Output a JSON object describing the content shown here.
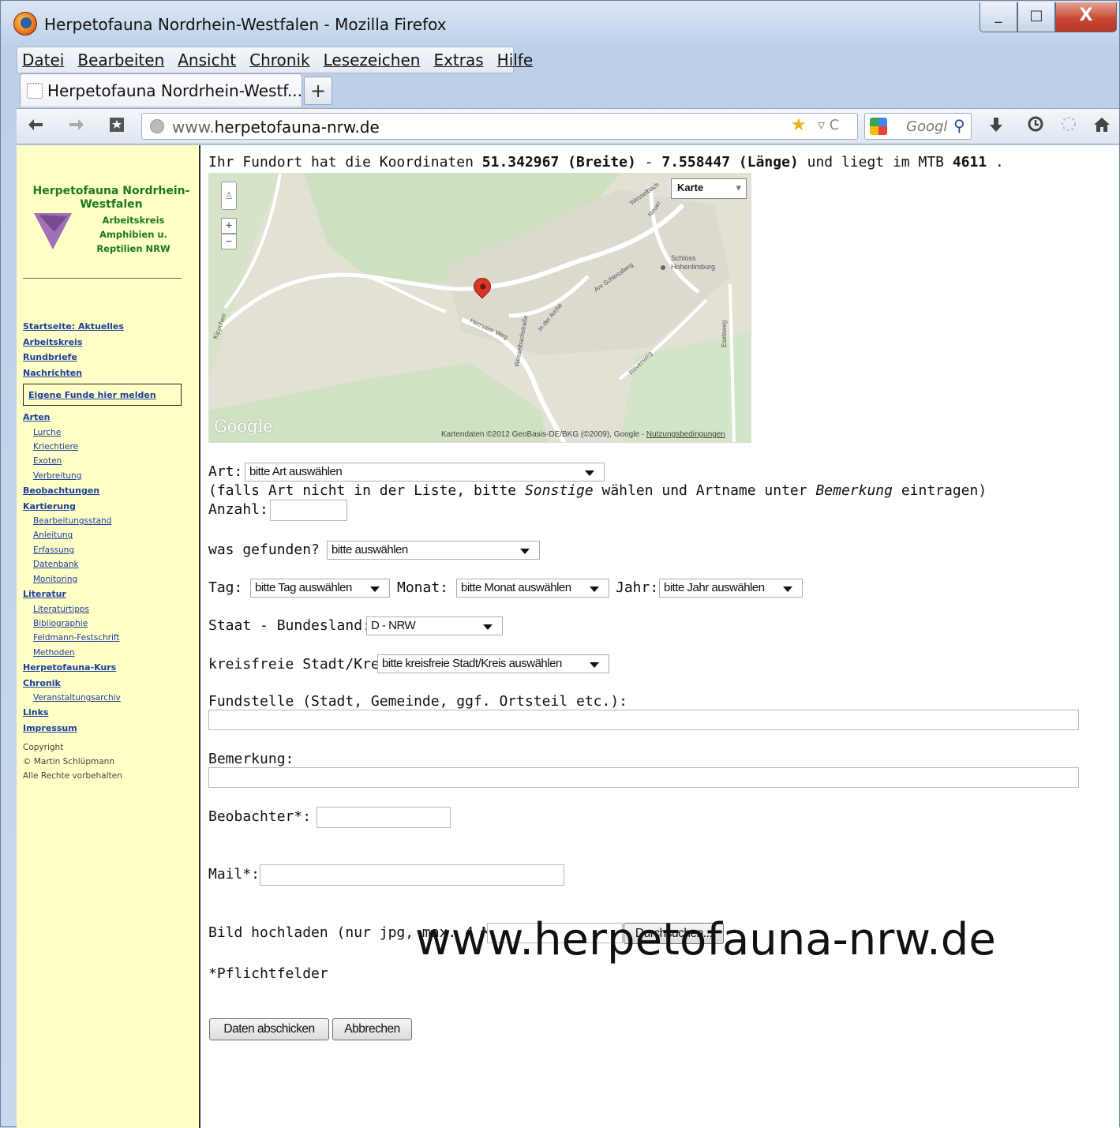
{
  "window": {
    "title": "Herpetofauna Nordrhein-Westfalen - Mozilla Firefox",
    "minimize": "_",
    "maximize": "□",
    "close": "X"
  },
  "menubar": [
    "Datei",
    "Bearbeiten",
    "Ansicht",
    "Chronik",
    "Lesezeichen",
    "Extras",
    "Hilfe"
  ],
  "tabs": [
    {
      "label": "Herpetofauna Nordrhein-Westf..."
    }
  ],
  "newtab": "+",
  "nav": {
    "back": "◆",
    "url_prefix": "www.",
    "url_host": "herpetofauna-nrw.de",
    "search_placeholder": "Googl",
    "icons": [
      "back-icon",
      "forward-icon",
      "bookmark-page-icon",
      "globe-icon",
      "star-icon",
      "reload-icon",
      "google-icon",
      "search-icon",
      "download-icon",
      "history-icon",
      "sync-icon",
      "home-icon"
    ]
  },
  "sidebar": {
    "brand_title": "Herpetofauna Nordrhein-Westfalen",
    "brand_sub": "Arbeitskreis Amphibien u. Reptilien NRW",
    "items": [
      {
        "label": "Startseite: Aktuelles",
        "level": 0
      },
      {
        "label": "Arbeitskreis",
        "level": 0
      },
      {
        "label": "Rundbriefe",
        "level": 0
      },
      {
        "label": "Nachrichten",
        "level": 0
      },
      {
        "label": "Eigene Funde hier melden",
        "level": 0,
        "boxed": true
      },
      {
        "label": "Arten",
        "level": 0
      },
      {
        "label": "Lurche",
        "level": 1
      },
      {
        "label": "Kriechtiere",
        "level": 1
      },
      {
        "label": "Exoten",
        "level": 1
      },
      {
        "label": "Verbreitung",
        "level": 1
      },
      {
        "label": "Beobachtungen",
        "level": 0
      },
      {
        "label": "Kartierung",
        "level": 0
      },
      {
        "label": "Bearbeitungsstand",
        "level": 1
      },
      {
        "label": "Anleitung",
        "level": 1
      },
      {
        "label": "Erfassung",
        "level": 1
      },
      {
        "label": "Datenbank",
        "level": 1
      },
      {
        "label": "Monitoring",
        "level": 1
      },
      {
        "label": "Literatur",
        "level": 0
      },
      {
        "label": "Literaturtipps",
        "level": 1
      },
      {
        "label": "Bibliographie",
        "level": 1
      },
      {
        "label": "Feldmann-Festschrift",
        "level": 1
      },
      {
        "label": "Methoden",
        "level": 1
      },
      {
        "label": "Herpetofauna-Kurs",
        "level": 0
      },
      {
        "label": "Chronik",
        "level": 0
      },
      {
        "label": "Veranstaltungsarchiv",
        "level": 1
      },
      {
        "label": "Links",
        "level": 0
      },
      {
        "label": "Impressum",
        "level": 0
      }
    ],
    "copyright": [
      "Copyright",
      "© Martin Schlüpmann",
      "Alle Rechte vorbehalten"
    ]
  },
  "main": {
    "coord_prefix": "Ihr Fundort hat die Koordinaten ",
    "lat": "51.342967 (Breite)",
    "sep": " - ",
    "lon": "7.558447 (Länge)",
    "coord_mid": " und liegt im MTB ",
    "mtb": "4611",
    "coord_end": " .",
    "map": {
      "type_label": "Karte",
      "zoom_in": "+",
      "zoom_out": "−",
      "google": "Google",
      "attribution": "Kartendaten ©2012 GeoBasis-DE/BKG (©2009), Google - ",
      "terms": "Nutzungsbedingungen",
      "labels": [
        "Schloss Hohenlimburg",
        "Am Schlossberg",
        "Herrsaier Weg",
        "In der Arche",
        "Wesselbachstraße",
        "Rövenweg",
        "Eselsweg",
        "Kippchen",
        "Wesselbach",
        "Neuer"
      ]
    },
    "art_label": "Art:",
    "art_value": "bitte Art auswählen",
    "hint_pre": "(falls Art nicht in der Liste, bitte ",
    "hint_em1": "Sonstige",
    "hint_mid": " wählen und Artname unter ",
    "hint_em2": "Bemerkung",
    "hint_post": " eintragen)",
    "anzahl_label": "Anzahl:",
    "was_label": "was gefunden?",
    "was_value": "bitte auswählen",
    "tag_label": "Tag:",
    "tag_value": "bitte Tag auswählen",
    "monat_label": "Monat:",
    "monat_value": "bitte Monat auswählen",
    "jahr_label": "Jahr:",
    "jahr_value": "bitte Jahr auswählen",
    "staat_label": "Staat - Bundesland:",
    "staat_value": "D - NRW",
    "kreis_label": "kreisfreie Stadt/Kreis:",
    "kreis_value": "bitte kreisfreie Stadt/Kreis auswählen",
    "fundstelle_label": "Fundstelle (Stadt, Gemeinde, ggf. Ortsteil etc.):",
    "bemerkung_label": "Bemerkung:",
    "beobachter_label": "Beobachter*:",
    "mail_label": "Mail*:",
    "bild_label": "Bild hochladen (nur jpg, max. 4 MB):",
    "browse_button": "Durchsuchen...",
    "pflicht": "*Pflichtfelder",
    "submit_button": "Daten abschicken",
    "cancel_button": "Abbrechen"
  },
  "watermark": "www.herpetofauna-nrw.de"
}
